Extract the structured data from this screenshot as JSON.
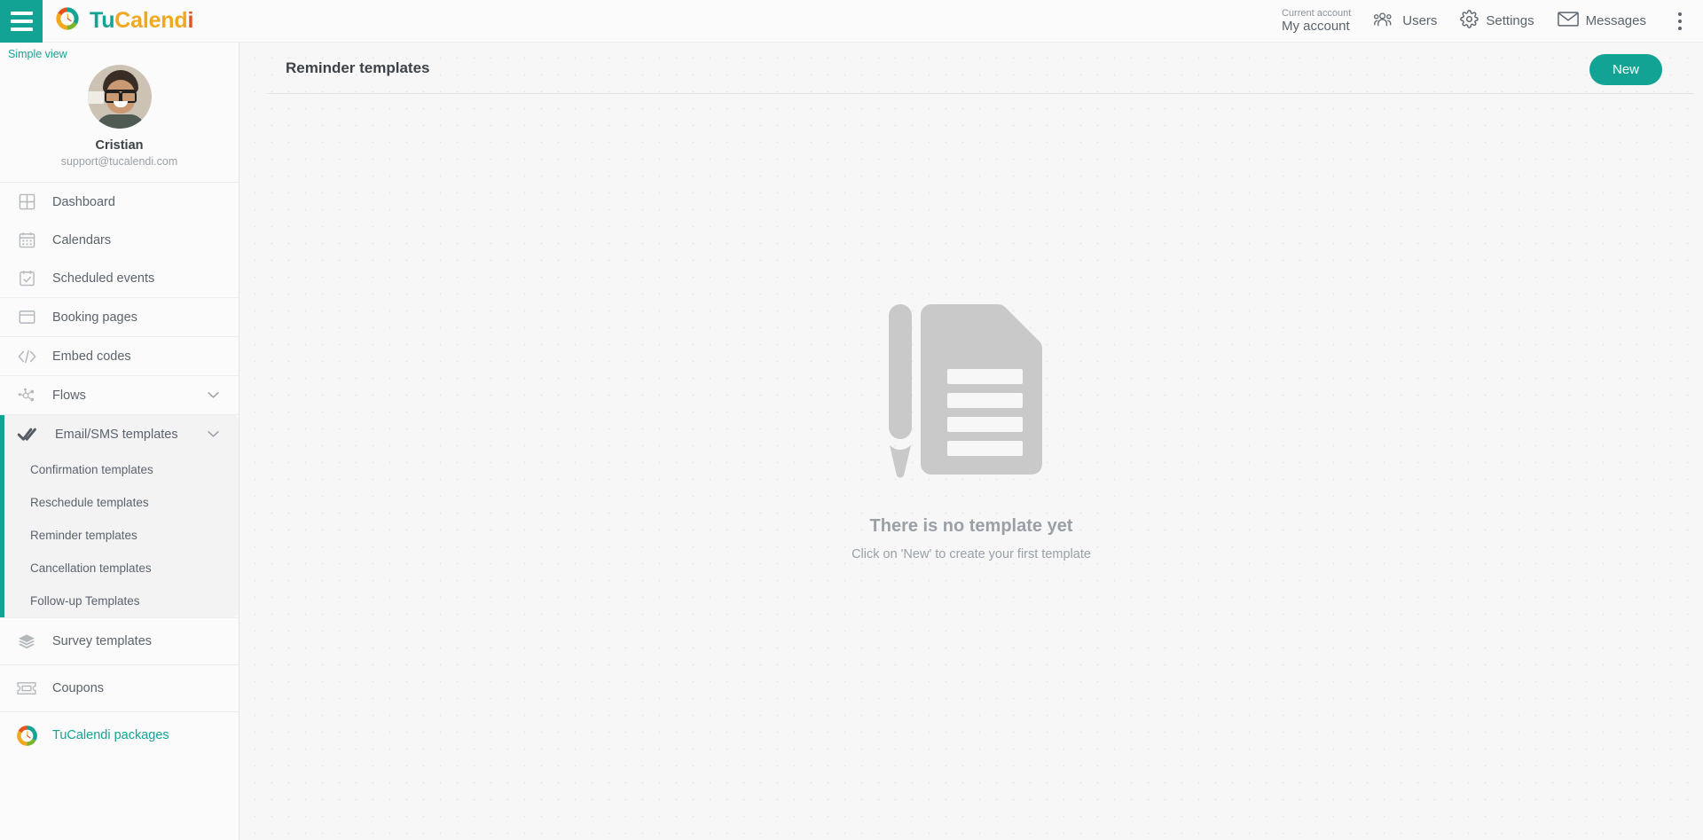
{
  "topbar": {
    "menu_icon": "hamburger-icon",
    "brand": {
      "part1": "Tu",
      "part2": "Calend",
      "part3": "i"
    },
    "account": {
      "label": "Current account",
      "value": "My account"
    },
    "nav": [
      {
        "label": "Users",
        "icon": "users-icon"
      },
      {
        "label": "Settings",
        "icon": "gear-icon"
      },
      {
        "label": "Messages",
        "icon": "envelope-icon"
      }
    ],
    "overflow_icon": "kebab-menu-icon"
  },
  "sidebar": {
    "simple_view": "Simple view",
    "profile": {
      "name": "Cristian",
      "email": "support@tucalendi.com",
      "avatar": "user-avatar"
    },
    "items": [
      {
        "label": "Dashboard",
        "icon": "dashboard-grid-icon"
      },
      {
        "label": "Calendars",
        "icon": "calendar-icon"
      },
      {
        "label": "Scheduled events",
        "icon": "calendar-check-icon"
      },
      {
        "label": "Booking pages",
        "icon": "window-icon"
      },
      {
        "label": "Embed codes",
        "icon": "code-brackets-icon"
      },
      {
        "label": "Flows",
        "icon": "nodes-icon",
        "chevron": "chevron-down-icon"
      }
    ],
    "active_section": {
      "label": "Email/SMS templates",
      "icon": "double-check-icon",
      "chevron": "chevron-down-icon",
      "subitems": [
        "Confirmation templates",
        "Reschedule templates",
        "Reminder templates",
        "Cancellation templates",
        "Follow-up Templates"
      ]
    },
    "bottom_items": [
      {
        "label": "Survey templates",
        "icon": "layers-icon"
      },
      {
        "label": "Coupons",
        "icon": "ticket-icon"
      }
    ],
    "packages": {
      "label": "TuCalendi packages",
      "icon": "tucalendi-logo-icon"
    }
  },
  "main": {
    "page_title": "Reminder templates",
    "new_button": "New",
    "empty_state": {
      "illustration": "document-with-pencil-icon",
      "title": "There is no template yet",
      "subtitle": "Click on 'New' to create your first template"
    }
  },
  "colors": {
    "accent": "#13a395",
    "brand_orange": "#f0a81e",
    "brand_red": "#e8521e",
    "text": "#5c636d",
    "muted": "#9aa0a6",
    "page_bg": "#f7f7f7"
  }
}
